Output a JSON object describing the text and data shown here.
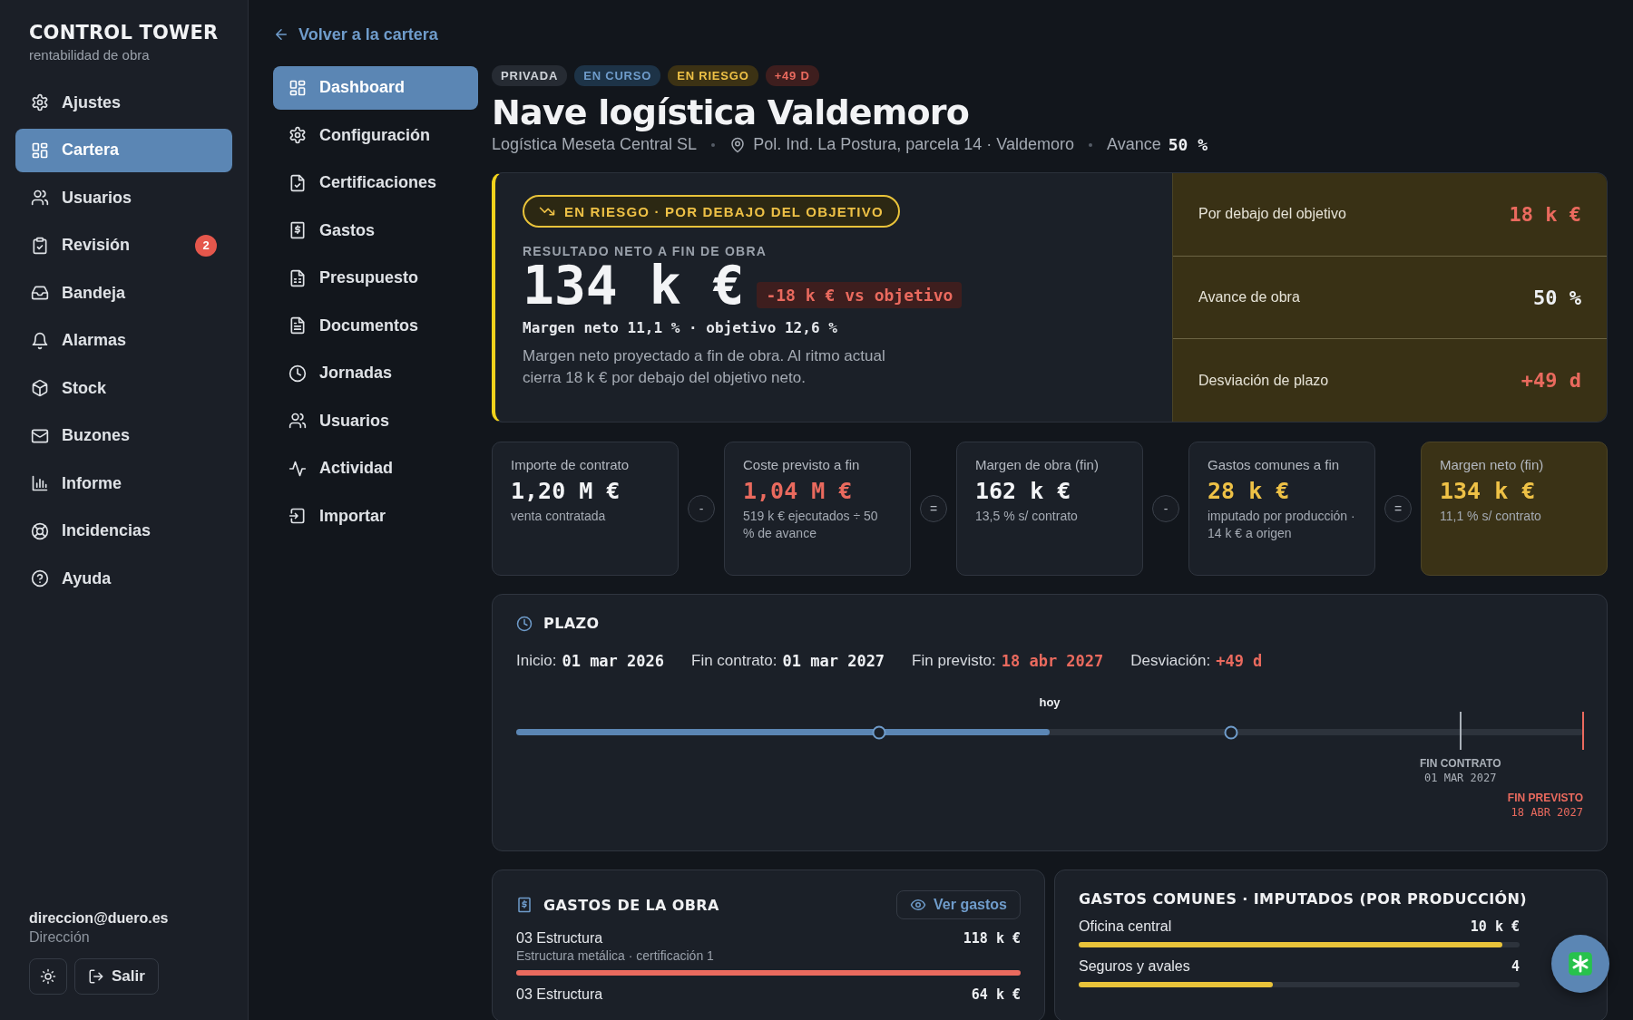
{
  "sidebar": {
    "brand": "CONTROL TOWER",
    "subtitle": "rentabilidad de obra",
    "items": [
      {
        "label": "Ajustes",
        "selected": false
      },
      {
        "label": "Cartera",
        "selected": true
      },
      {
        "label": "Usuarios",
        "selected": false
      },
      {
        "label": "Revisión",
        "selected": false,
        "badge": "2"
      },
      {
        "label": "Bandeja",
        "selected": false
      },
      {
        "label": "Alarmas",
        "selected": false
      },
      {
        "label": "Stock",
        "selected": false
      },
      {
        "label": "Buzones",
        "selected": false
      },
      {
        "label": "Informe",
        "selected": false
      },
      {
        "label": "Incidencias",
        "selected": false
      },
      {
        "label": "Ayuda",
        "selected": false
      }
    ],
    "user": {
      "email": "direccion@duero.es",
      "role": "Dirección"
    },
    "logout": "Salir"
  },
  "subnav": {
    "back": "Volver a la cartera",
    "items": [
      {
        "label": "Dashboard",
        "selected": true
      },
      {
        "label": "Configuración",
        "selected": false
      },
      {
        "label": "Certificaciones",
        "selected": false
      },
      {
        "label": "Gastos",
        "selected": false
      },
      {
        "label": "Presupuesto",
        "selected": false
      },
      {
        "label": "Documentos",
        "selected": false
      },
      {
        "label": "Jornadas",
        "selected": false
      },
      {
        "label": "Usuarios",
        "selected": false
      },
      {
        "label": "Actividad",
        "selected": false
      },
      {
        "label": "Importar",
        "selected": false
      }
    ]
  },
  "project": {
    "tags": [
      {
        "label": "PRIVADA",
        "kind": "neutral"
      },
      {
        "label": "EN CURSO",
        "kind": "info"
      },
      {
        "label": "EN RIESGO",
        "kind": "warning"
      },
      {
        "label": "+49 D",
        "kind": "danger"
      }
    ],
    "title": "Nave logística Valdemoro",
    "client": "Logística Meseta Central SL",
    "location": "Pol. Ind. La Postura, parcela 14 · Valdemoro",
    "progress_label": "Avance",
    "progress_value": "50 %"
  },
  "result": {
    "alert": "EN RIESGO · POR DEBAJO DEL OBJETIVO",
    "label": "RESULTADO NETO A FIN DE OBRA",
    "value": "134 k €",
    "delta": "-18 k € vs objetivo",
    "margin": "Margen neto 11,1 % · objetivo 12,6 %",
    "note": "Margen neto proyectado a fin de obra. Al ritmo actual cierra 18 k € por debajo del objetivo neto.",
    "stats": [
      {
        "label": "Por debajo del objetivo",
        "value": "18 k €",
        "color": "#ea6a5e"
      },
      {
        "label": "Avance de obra",
        "value": "50 %",
        "color": "#eef0f3"
      },
      {
        "label": "Desviación de plazo",
        "value": "+49 d",
        "color": "#ea6a5e"
      }
    ]
  },
  "waterfall": [
    {
      "label": "Importe de contrato",
      "value": "1,20 M €",
      "note": "venta contratada",
      "color": "#f3f4f6",
      "highlight": false,
      "operator": "-"
    },
    {
      "label": "Coste previsto a fin",
      "value": "1,04 M €",
      "note": "519 k € ejecutados ÷ 50 % de avance",
      "color": "#ea6a5e",
      "highlight": false,
      "operator": "="
    },
    {
      "label": "Margen de obra (fin)",
      "value": "162 k €",
      "note": "13,5 % s/ contrato",
      "color": "#f3f4f6",
      "highlight": false,
      "operator": "-"
    },
    {
      "label": "Gastos comunes a fin",
      "value": "28 k €",
      "note": "imputado por producción · 14 k € a origen",
      "color": "#eec146",
      "highlight": false,
      "operator": "="
    },
    {
      "label": "Margen neto (fin)",
      "value": "134 k €",
      "note": "11,1 % s/ contrato",
      "color": "#eec146",
      "highlight": true
    }
  ],
  "schedule": {
    "title": "PLAZO",
    "facts": [
      {
        "label": "Inicio:",
        "value": "01 mar 2026",
        "color": "#eef0f3"
      },
      {
        "label": "Fin contrato:",
        "value": "01 mar 2027",
        "color": "#eef0f3"
      },
      {
        "label": "Fin previsto:",
        "value": "18 abr 2027",
        "color": "#ea6a5e"
      },
      {
        "label": "Desviación:",
        "value": "+49 d",
        "color": "#ea6a5e"
      }
    ],
    "today_label": "hoy",
    "level": 0.5,
    "markers": [
      {
        "title": "FIN CONTRATO",
        "date": "01 MAR 2027",
        "color": "#aab0b8"
      },
      {
        "title": "FIN PREVISTO",
        "date": "18 ABR 2027",
        "color": "#ea6a5e"
      }
    ]
  },
  "expenses": {
    "title": "GASTOS DE LA OBRA",
    "button": "Ver gastos",
    "rows": [
      {
        "name": "03 Estructura",
        "detail": "Estructura metálica · certificación 1",
        "value": "118 k €",
        "level": 1
      },
      {
        "name": "03 Estructura",
        "value": "64 k €"
      }
    ]
  },
  "common_expenses": {
    "title": "GASTOS COMUNES · IMPUTADOS (POR PRODUCCIÓN)",
    "rows": [
      {
        "name": "Oficina central",
        "value": "10 k €",
        "level": 0.96
      },
      {
        "name": "Seguros y avales",
        "value": "4",
        "level": 0.44
      }
    ]
  }
}
